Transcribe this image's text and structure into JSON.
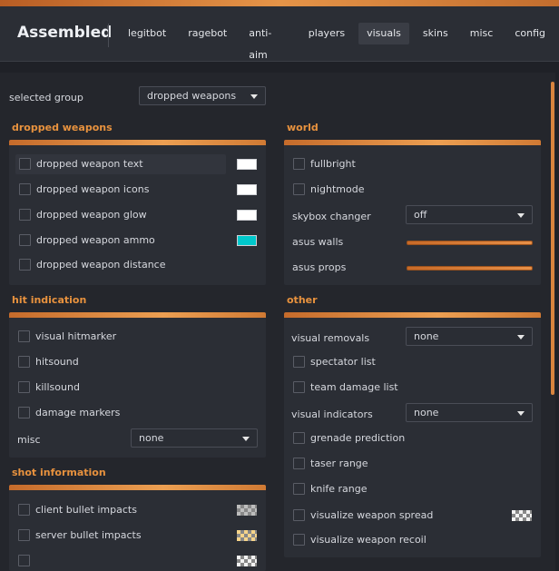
{
  "app": {
    "title": "Assembled"
  },
  "nav": {
    "tabs": [
      {
        "label": "legitbot"
      },
      {
        "label": "ragebot"
      },
      {
        "label": "anti-aim"
      },
      {
        "label": "players"
      },
      {
        "label": "visuals"
      },
      {
        "label": "skins"
      },
      {
        "label": "misc"
      },
      {
        "label": "config"
      }
    ],
    "active": "visuals"
  },
  "selected_group": {
    "label": "selected group",
    "value": "dropped weapons"
  },
  "colors": {
    "accent": "#e8923e",
    "cyan": "#00c8cc"
  },
  "dropped_weapons": {
    "title": "dropped weapons",
    "items": [
      {
        "label": "dropped weapon text",
        "swatch": "#ffffff"
      },
      {
        "label": "dropped weapon icons",
        "swatch": "#ffffff"
      },
      {
        "label": "dropped weapon glow",
        "swatch": "#ffffff"
      },
      {
        "label": "dropped weapon ammo",
        "swatch": "#00c8cc"
      },
      {
        "label": "dropped weapon distance"
      }
    ]
  },
  "world": {
    "title": "world",
    "fullbright": "fullbright",
    "nightmode": "nightmode",
    "skybox_label": "skybox changer",
    "skybox_value": "off",
    "asus_walls": "asus walls",
    "asus_props": "asus props"
  },
  "hit_indication": {
    "title": "hit indication",
    "items": [
      {
        "label": "visual hitmarker"
      },
      {
        "label": "hitsound"
      },
      {
        "label": "killsound"
      },
      {
        "label": "damage markers"
      }
    ],
    "misc_label": "misc",
    "misc_value": "none"
  },
  "other": {
    "title": "other",
    "visual_removals_label": "visual removals",
    "visual_removals_value": "none",
    "spectator_list": "spectator list",
    "team_damage_list": "team damage list",
    "visual_indicators_label": "visual indicators",
    "visual_indicators_value": "none",
    "grenade_prediction": "grenade prediction",
    "taser_range": "taser range",
    "knife_range": "knife range",
    "visualize_weapon_spread": "visualize weapon spread",
    "visualize_weapon_recoil": "visualize weapon recoil"
  },
  "shot_information": {
    "title": "shot information",
    "items": [
      {
        "label": "client bullet impacts"
      },
      {
        "label": "server bullet impacts"
      }
    ]
  }
}
